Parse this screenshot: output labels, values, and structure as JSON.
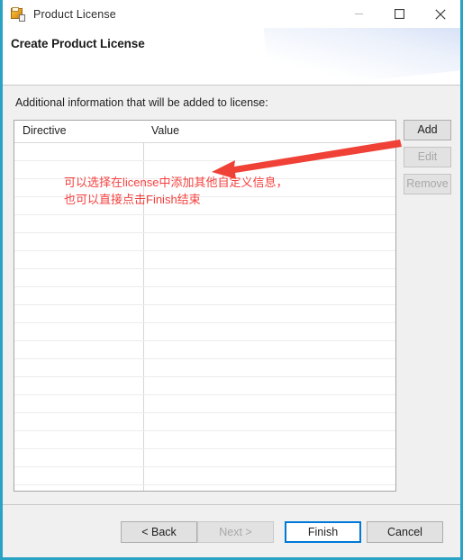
{
  "window": {
    "title": "Product License",
    "icon": "product-license-app-icon",
    "controls": {
      "minimize": "minimize-icon",
      "maximize": "maximize-icon",
      "close": "close-icon"
    },
    "border_color": "#29a3c4"
  },
  "header": {
    "title": "Create Product License"
  },
  "content": {
    "instruction": "Additional information that will be added to license:",
    "table": {
      "columns": [
        "Directive",
        "Value"
      ],
      "rows": [],
      "empty_row_count": 20
    },
    "side_buttons": [
      {
        "label": "Add",
        "enabled": true
      },
      {
        "label": "Edit",
        "enabled": false
      },
      {
        "label": "Remove",
        "enabled": false
      }
    ]
  },
  "footer": {
    "buttons": [
      {
        "label": "< Back",
        "enabled": true,
        "focused": false
      },
      {
        "label": "Next >",
        "enabled": false,
        "focused": false
      },
      {
        "label": "Finish",
        "enabled": true,
        "focused": true
      },
      {
        "label": "Cancel",
        "enabled": true,
        "focused": false
      }
    ]
  },
  "annotation": {
    "color": "#f4413f",
    "text_line1": "可以选择在license中添加其他自定义信息，",
    "text_line2": "也可以直接点击Finish结束",
    "arrow": "red-arrow-pointing-left"
  }
}
